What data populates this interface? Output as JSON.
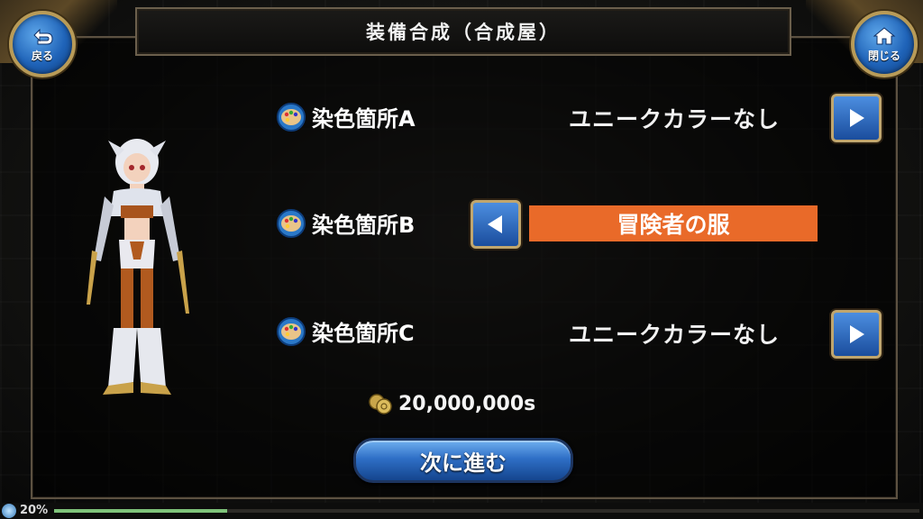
{
  "header": {
    "title": "装備合成（合成屋）"
  },
  "nav": {
    "back_label": "戻る",
    "close_label": "閉じる"
  },
  "dye_rows": [
    {
      "label": "染色箇所A",
      "value": "ユニークカラーなし",
      "selected": false,
      "arrow": "right"
    },
    {
      "label": "染色箇所B",
      "value": "冒険者の服",
      "selected": true,
      "arrow": "left"
    },
    {
      "label": "染色箇所C",
      "value": "ユニークカラーなし",
      "selected": false,
      "arrow": "right"
    }
  ],
  "cost": {
    "amount": "20,000,000s",
    "icon": "coin-icon"
  },
  "actions": {
    "next_label": "次に進む"
  },
  "progress": {
    "text": "20%",
    "value": 0.2
  },
  "colors": {
    "selected_bar": "#e96a29",
    "button_blue": "#2f6fc6",
    "frame_gold": "#b89b58"
  }
}
